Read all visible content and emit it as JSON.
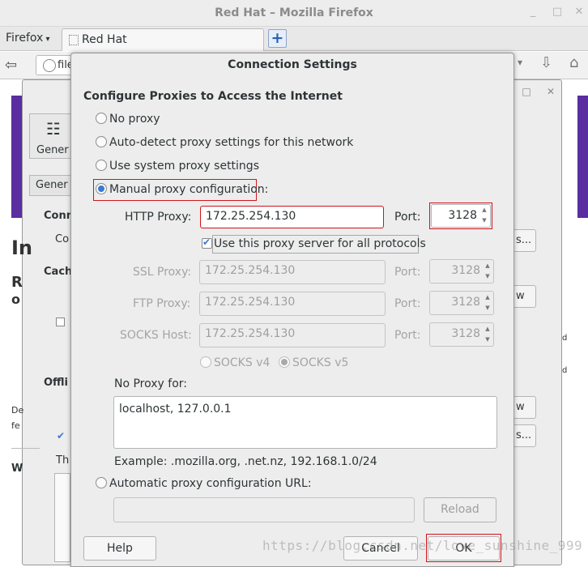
{
  "window": {
    "title": "Red Hat – Mozilla Firefox"
  },
  "toolbar": {
    "firefox_menu": "Firefox",
    "tab_label": "Red Hat",
    "url_partial": "file"
  },
  "background": {
    "general_tab": "Gener",
    "general_section": "Gener",
    "conn": "Conn",
    "co": "Co",
    "cach": "Cach",
    "offli": "Offli",
    "big_i": "In",
    "r": "R",
    "o": "o",
    "de": "De",
    "fe": "fe",
    "th": "Th",
    "w": "W",
    "btn_dots1": "s...",
    "btn_w1": "w",
    "btn_w2": "w",
    "btn_dots2": "s...",
    "frag_d1": "d",
    "frag_d2": "d"
  },
  "dialog": {
    "title": "Connection Settings",
    "heading": "Configure Proxies to Access the Internet",
    "options": {
      "no_proxy": "No proxy",
      "auto_detect": "Auto-detect proxy settings for this network",
      "system": "Use system proxy settings",
      "manual": "Manual proxy configuration:",
      "auto_url": "Automatic proxy configuration URL:"
    },
    "http": {
      "label": "HTTP Proxy:",
      "value": "172.25.254.130",
      "port_label": "Port:",
      "port": "3128"
    },
    "use_all_protocols": "Use this proxy server for all protocols",
    "ssl": {
      "label": "SSL Proxy:",
      "value": "172.25.254.130",
      "port_label": "Port:",
      "port": "3128"
    },
    "ftp": {
      "label": "FTP Proxy:",
      "value": "172.25.254.130",
      "port_label": "Port:",
      "port": "3128"
    },
    "socks": {
      "label": "SOCKS Host:",
      "value": "172.25.254.130",
      "port_label": "Port:",
      "port": "3128"
    },
    "socks_v4": "SOCKS v4",
    "socks_v5": "SOCKS v5",
    "no_proxy_label": "No Proxy for:",
    "no_proxy_value": "localhost, 127.0.0.1",
    "example": "Example: .mozilla.org, .net.nz, 192.168.1.0/24",
    "auto_url_value": "",
    "buttons": {
      "reload": "Reload",
      "help": "Help",
      "cancel": "Cancel",
      "ok": "OK"
    }
  },
  "watermark": "https://blog.csdn.net/love_sunshine_999",
  "colors": {
    "highlight_red": "#d0141c",
    "radio_blue": "#3a79d5",
    "purple_bg": "#5a2da0"
  }
}
